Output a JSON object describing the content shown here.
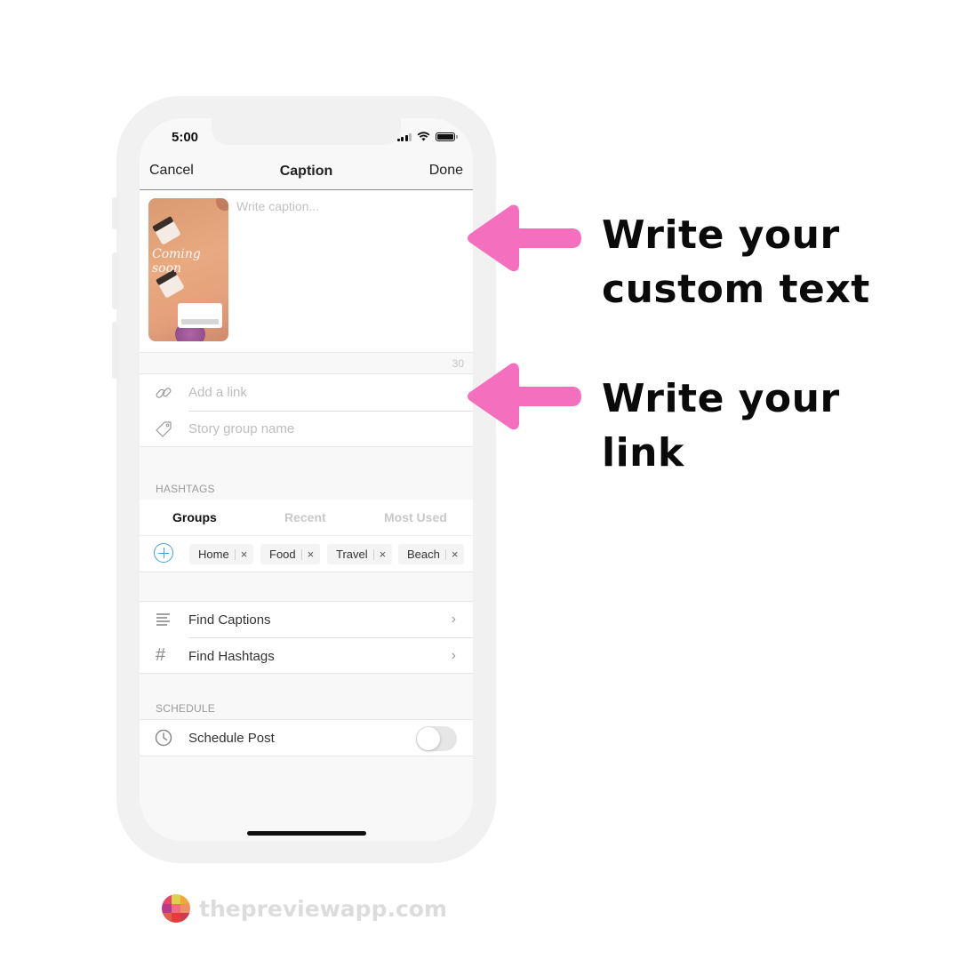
{
  "status_bar": {
    "time": "5:00",
    "icons": [
      "cellular-signal-icon",
      "wifi-icon",
      "battery-icon"
    ]
  },
  "navbar": {
    "cancel_label": "Cancel",
    "title": "Caption",
    "done_label": "Done"
  },
  "caption": {
    "placeholder": "Write caption...",
    "value": "",
    "thumbnail_text": "Coming soon",
    "char_counter": "30"
  },
  "fields": {
    "link_placeholder": "Add a link",
    "story_group_placeholder": "Story group name"
  },
  "hashtags": {
    "section_label": "HASHTAGS",
    "tabs": [
      {
        "label": "Groups",
        "active": true
      },
      {
        "label": "Recent",
        "active": false
      },
      {
        "label": "Most Used",
        "active": false
      }
    ],
    "chips": [
      {
        "label": "Home",
        "remove": "×"
      },
      {
        "label": "Food",
        "remove": "×"
      },
      {
        "label": "Travel",
        "remove": "×"
      },
      {
        "label": "Beach",
        "remove": "×"
      }
    ]
  },
  "find_menu": [
    {
      "label": "Find Captions",
      "icon": "text-lines-icon",
      "chevron": "›"
    },
    {
      "label": "Find Hashtags",
      "icon": "hashtag-icon",
      "glyph": "#",
      "chevron": "›"
    }
  ],
  "schedule": {
    "section_label": "SCHEDULE",
    "row_label": "Schedule Post",
    "toggle_on": false
  },
  "annotations": [
    {
      "line1": "Write your",
      "line2": "custom text"
    },
    {
      "line1": "Write your",
      "line2": "link"
    }
  ],
  "colors": {
    "arrow": "#f46fbd",
    "accent_blue": "#4a9fd8"
  },
  "brand": {
    "text": "thepreviewapp.com",
    "logo_colors": [
      "#e8456b",
      "#d9d24a",
      "#f3a43a",
      "#b83a8f",
      "#ef6e7a",
      "#f08f62",
      "#e0614c",
      "#e83a3a",
      "#cf3b50"
    ]
  }
}
